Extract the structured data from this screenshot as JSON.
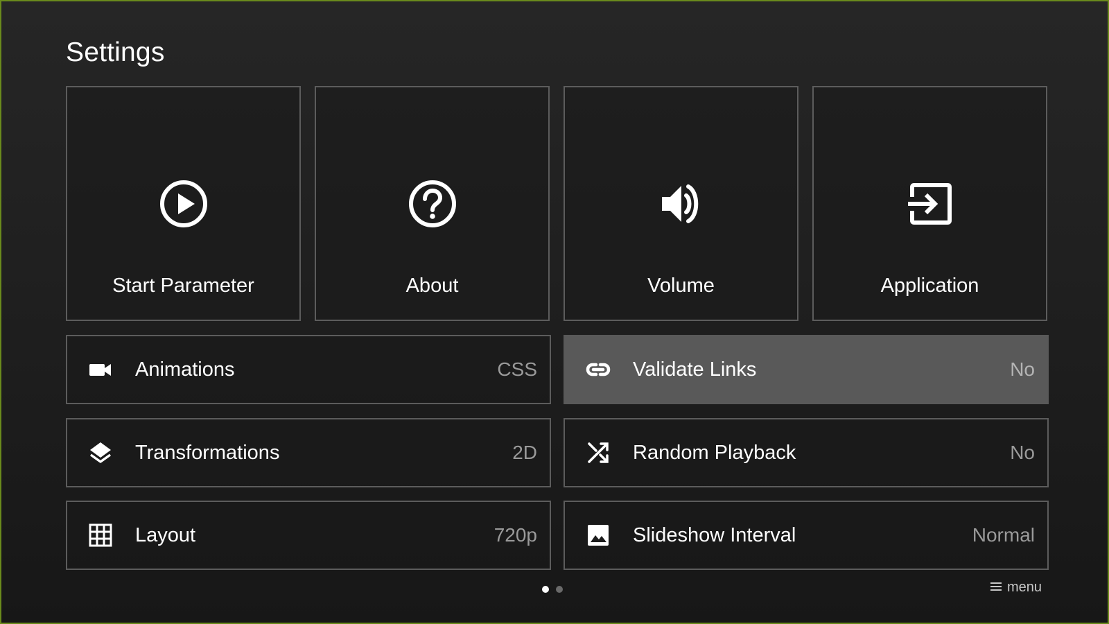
{
  "header": {
    "title": "Settings"
  },
  "tiles": [
    {
      "label": "Start Parameter",
      "icon": "play-circle-icon"
    },
    {
      "label": "About",
      "icon": "help-circle-icon"
    },
    {
      "label": "Volume",
      "icon": "volume-icon"
    },
    {
      "label": "Application",
      "icon": "exit-to-app-icon"
    }
  ],
  "rows": [
    {
      "label": "Animations",
      "value": "CSS",
      "icon": "videocam-icon"
    },
    {
      "label": "Validate Links",
      "value": "No",
      "icon": "link-icon",
      "selected": true
    },
    {
      "label": "Transformations",
      "value": "2D",
      "icon": "layers-icon"
    },
    {
      "label": "Random Playback",
      "value": "No",
      "icon": "shuffle-icon"
    },
    {
      "label": "Layout",
      "value": "720p",
      "icon": "grid-icon"
    },
    {
      "label": "Slideshow Interval",
      "value": "Normal",
      "icon": "image-icon"
    }
  ],
  "pagination": {
    "current": 1,
    "total": 2
  },
  "footer": {
    "menu_label": "menu",
    "menu_icon": "menu-icon"
  },
  "colors": {
    "frame_border": "#6a8a1c",
    "selected_row": "#595959",
    "tile_border": "#5c5c5c"
  }
}
